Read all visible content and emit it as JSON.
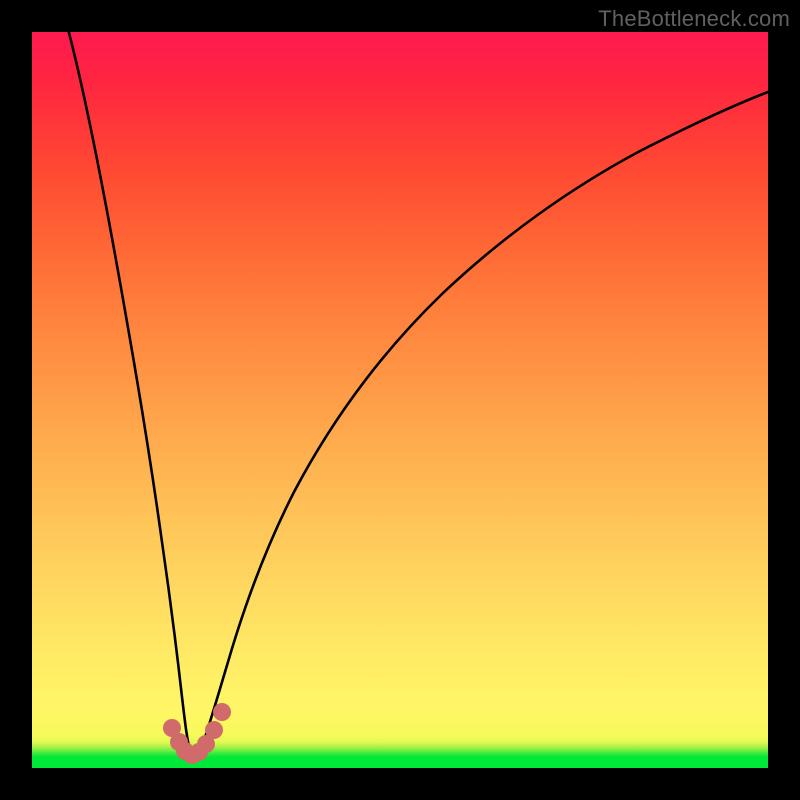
{
  "watermark": "TheBottleneck.com",
  "chart_data": {
    "type": "line",
    "title": "",
    "xlabel": "",
    "ylabel": "",
    "xlim": [
      0,
      100
    ],
    "ylim": [
      0,
      100
    ],
    "grid": false,
    "series": [
      {
        "name": "bottleneck-curve",
        "color": "#000000",
        "x": [
          5,
          7,
          9,
          11,
          13,
          15,
          16.5,
          18,
          19,
          19.8,
          20.5,
          21.2,
          22,
          23,
          24.2,
          26,
          28,
          31,
          35,
          40,
          46,
          53,
          61,
          70,
          80,
          90,
          100
        ],
        "y": [
          100,
          88,
          76,
          64,
          52,
          40,
          30,
          20,
          12,
          6,
          2.5,
          2.5,
          6,
          13,
          22,
          33,
          42,
          52,
          61,
          68.5,
          74.5,
          79.5,
          83.5,
          86.8,
          89.5,
          91.5,
          93
        ]
      },
      {
        "name": "valley-highlight",
        "color": "#d16a6a",
        "x": [
          18.2,
          18.9,
          19.6,
          20.3,
          21.0,
          21.7,
          22.4,
          23.1,
          23.8
        ],
        "y": [
          7.0,
          4.0,
          2.3,
          2.0,
          2.3,
          3.3,
          5.0,
          7.3,
          10.0
        ]
      }
    ]
  },
  "colors": {
    "frame": "#000000",
    "curve": "#000000",
    "highlight": "#d16a6a"
  }
}
